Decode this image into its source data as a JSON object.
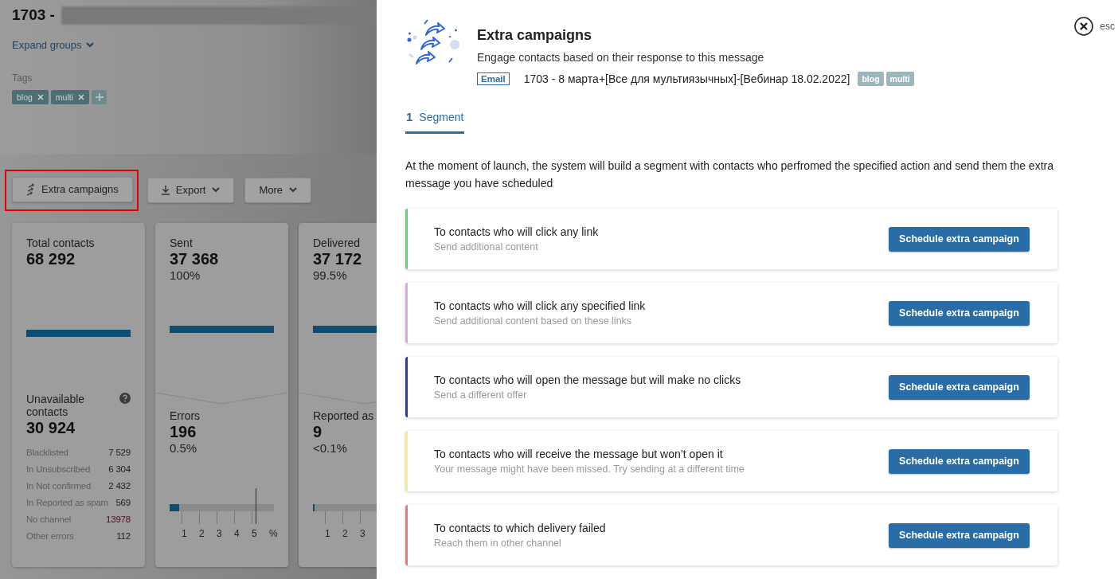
{
  "page": {
    "title": "1703 -",
    "expand_groups": "Expand groups",
    "tags_label": "Tags",
    "tags": [
      "blog",
      "multi"
    ],
    "toolbar": [
      {
        "label": "Extra campaigns",
        "kind": "extra",
        "highlighted": true
      },
      {
        "label": "Export",
        "kind": "export",
        "highlighted": false
      },
      {
        "label": "More",
        "kind": "more",
        "highlighted": false
      }
    ],
    "total_card": {
      "label": "Total contacts",
      "value": "68 292",
      "level": 1,
      "unavailable_label": "Unavailable contacts",
      "unavailable_value": "30 924",
      "breakdown": [
        {
          "label": "Blacklisted",
          "value": "7 529",
          "alert": false
        },
        {
          "label": "In Unsubscribed",
          "value": "6 304",
          "alert": false
        },
        {
          "label": "In Not confirmed",
          "value": "2 432",
          "alert": false
        },
        {
          "label": "In Reported as spam",
          "value": "569",
          "alert": false
        },
        {
          "label": "No channel",
          "value": "13978",
          "alert": true
        },
        {
          "label": "Other errors",
          "value": "112",
          "alert": false
        }
      ]
    },
    "stat_cards": [
      {
        "label": "Sent",
        "value": "37 368",
        "percent": "100%",
        "level": 1,
        "sub": {
          "label": "Errors",
          "value": "196",
          "percent": "0.5%",
          "level": 0.09,
          "limit_marker": true,
          "ticks": [
            "1",
            "2",
            "3",
            "4",
            "5",
            "%"
          ]
        }
      },
      {
        "label": "Delivered",
        "value": "37 172",
        "percent": "99.5%",
        "level": 1,
        "sub": {
          "label": "Reported as",
          "value": "9",
          "percent": "<0.1%",
          "level": 0.015,
          "limit_marker": false,
          "ticks": [
            "1",
            "2",
            "3"
          ]
        }
      }
    ]
  },
  "panel": {
    "close_hint": "esc",
    "title": "Extra campaigns",
    "subtitle": "Engage contacts based on their response to this message",
    "channel": "Email",
    "message_name": "1703 - 8 марта+[Все для мультиязычных]-[Вебинар 18.02.2022]",
    "tags": [
      "blog",
      "multi"
    ],
    "tabs": [
      {
        "number": "1",
        "label": "Segment",
        "selected": true
      }
    ],
    "description": "At the moment of launch, the system will build a segment with contacts who perfromed the specified action and send them the extra message you have scheduled",
    "options": [
      {
        "title": "To contacts who will click any link",
        "subtitle": "Send additional content",
        "color": "#5cd66e",
        "button": "Schedule extra campaign"
      },
      {
        "title": "To contacts who will click any specified link",
        "subtitle": "Send additional content based on these links",
        "color": "#e3a6dc",
        "button": "Schedule extra campaign"
      },
      {
        "title": "To contacts who will open the message but will make no clicks",
        "subtitle": "Send a different offer",
        "color": "#2c3a9c",
        "button": "Schedule extra campaign"
      },
      {
        "title": "To contacts who will receive the message but won’t open it",
        "subtitle": "Your message might have been missed. Try sending at a different time",
        "color": "#f2ef8c",
        "button": "Schedule extra campaign"
      },
      {
        "title": "To contacts to which delivery failed",
        "subtitle": "Reach them in other channel",
        "color": "#ef7676",
        "button": "Schedule extra campaign"
      }
    ]
  }
}
